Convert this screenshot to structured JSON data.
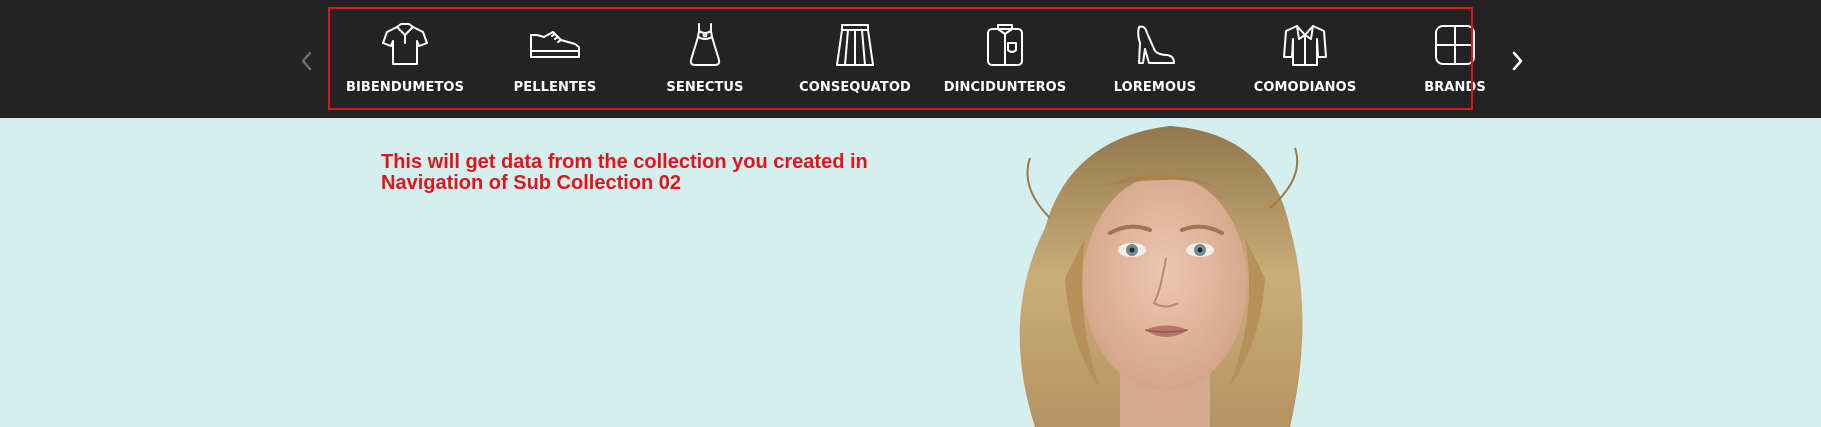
{
  "nav": {
    "prev_icon": "chevron-left-icon",
    "next_icon": "chevron-right-icon",
    "prev_color": "#6f6f6f",
    "next_color": "#ffffff"
  },
  "categories": [
    {
      "label": "BIBENDUMETOS",
      "icon": "polo-shirt-icon"
    },
    {
      "label": "PELLENTES",
      "icon": "sneaker-icon"
    },
    {
      "label": "SENECTUS",
      "icon": "dress-icon"
    },
    {
      "label": "CONSEQUATOD",
      "icon": "skirt-icon"
    },
    {
      "label": "DINCIDUNTEROS",
      "icon": "shirt-pocket-icon"
    },
    {
      "label": "LOREMOUS",
      "icon": "high-heel-icon"
    },
    {
      "label": "COMODIANOS",
      "icon": "jacket-icon"
    },
    {
      "label": "BRANDS",
      "icon": "grid-icon"
    }
  ],
  "hero": {
    "note_line1": "This will get data from the collection you created in",
    "note_line2": "Navigation of Sub Collection 02",
    "background_color": "#d5eeee"
  },
  "colors": {
    "topbar": "#232323",
    "highlight": "#e0141b",
    "label": "#ffffff"
  }
}
